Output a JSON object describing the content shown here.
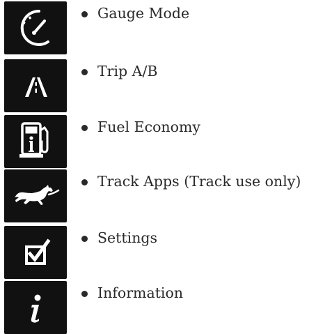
{
  "menu": {
    "items": [
      {
        "icon": "gauge-icon",
        "label": "Gauge Mode"
      },
      {
        "icon": "road-icon",
        "label": "Trip A/B"
      },
      {
        "icon": "fuel-pump-info-icon",
        "label": "Fuel Economy"
      },
      {
        "icon": "running-horse-icon",
        "label": "Track Apps (Track use only)"
      },
      {
        "icon": "checkbox-icon",
        "label": "Settings"
      },
      {
        "icon": "information-icon",
        "label": "Information"
      }
    ]
  },
  "colors": {
    "icon_background": "#111111",
    "icon_foreground": "#ffffff",
    "text": "#2a2a2a"
  }
}
